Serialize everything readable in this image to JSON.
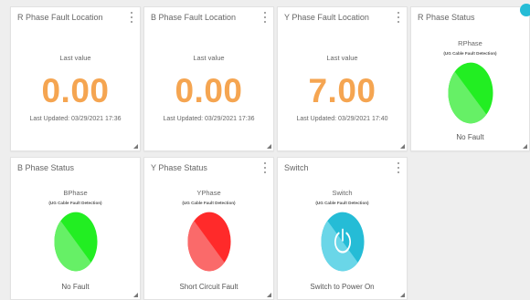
{
  "colors": {
    "value_orange": "#f5a551",
    "accent_teal": "#25bcd6"
  },
  "cards": {
    "r_location": {
      "title": "R Phase Fault Location",
      "label": "Last value",
      "value": "0.00",
      "updated": "Last Updated: 03/29/2021 17:36"
    },
    "b_location": {
      "title": "B Phase Fault Location",
      "label": "Last value",
      "value": "0.00",
      "updated": "Last Updated: 03/29/2021 17:36"
    },
    "y_location": {
      "title": "Y Phase Fault Location",
      "label": "Last value",
      "value": "7.00",
      "updated": "Last Updated: 03/29/2021 17:40"
    },
    "r_status": {
      "title": "R Phase Status",
      "gauge_name": "RPhase",
      "gauge_desc": "(UG Cable Fault Detection)",
      "status": "No Fault",
      "color_main": "#22ee22",
      "color_light": "#66f066"
    },
    "b_status": {
      "title": "B Phase Status",
      "gauge_name": "BPhase",
      "gauge_desc": "(UG Cable Fault Detection)",
      "status": "No Fault",
      "color_main": "#22ee22",
      "color_light": "#66f066"
    },
    "y_status": {
      "title": "Y Phase Status",
      "gauge_name": "YPhase",
      "gauge_desc": "(UG Cable Fault Detection)",
      "status": "Short Circuit Fault",
      "color_main": "#ff2a2a",
      "color_light": "#fa6a6a"
    },
    "switch": {
      "title": "Switch",
      "gauge_name": "Switch",
      "gauge_desc": "(UG Cable Fault Detection)",
      "status": "Switch to Power On",
      "icon": "power-icon",
      "color_main": "#25bcd6",
      "color_light": "#6ad6e8"
    }
  }
}
